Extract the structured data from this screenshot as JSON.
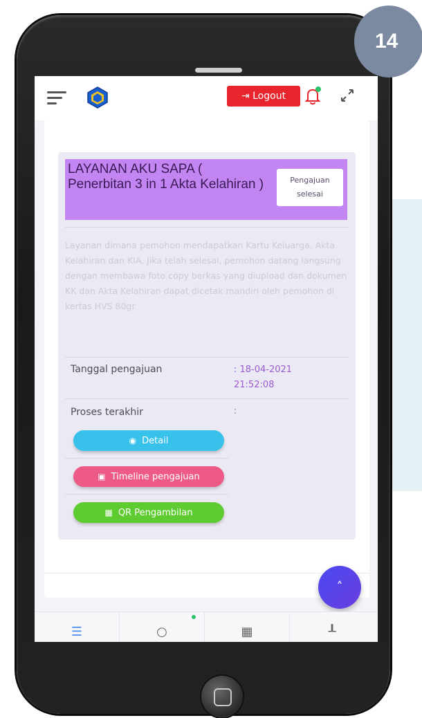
{
  "step_badge": "14",
  "header": {
    "logout_label": "Logout",
    "logout_icon": "logout-arrow-icon"
  },
  "service": {
    "title": "LAYANAN AKU SAPA ( Penerbitan 3 in 1 Akta Kelahiran )",
    "status_line1": "Pengajuan",
    "status_line2": "selesai",
    "description": "Layanan dimana pemohon mendapatkan Kartu Keluarga, Akta Kelahiran dan KIA. Jika telah selesai, pemohon datang langsung dengan membawa foto copy berkas yang diupload dan dokumen KK dan Akta Kelahiran dapat dicetak mandiri oleh pemohon di kertas HVS 80gr",
    "date_label": "Tanggal pengajuan",
    "date_value_1": ": 18-04-2021",
    "date_value_2": "21:52:08",
    "process_label": "Proses terakhir",
    "process_value": ":"
  },
  "buttons": {
    "detail": "Detail",
    "timeline": "Timeline pengajuan",
    "qr": "QR Pengambilan"
  },
  "colors": {
    "logout": "#e8252d",
    "header_bg": "#c285f2",
    "detail": "#38c1ea",
    "timeline": "#ee5a86",
    "qr": "#5ecb30",
    "fab": "#4a4af0"
  }
}
